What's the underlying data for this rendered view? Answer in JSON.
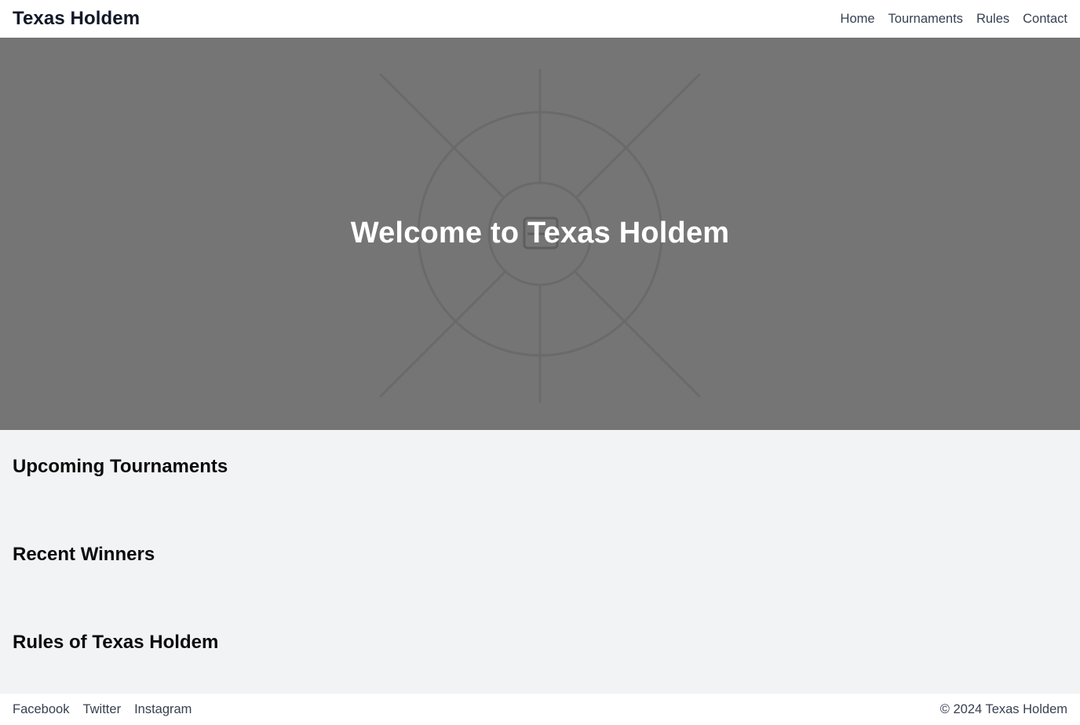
{
  "header": {
    "brand": "Texas Holdem",
    "nav": [
      {
        "label": "Home"
      },
      {
        "label": "Tournaments"
      },
      {
        "label": "Rules"
      },
      {
        "label": "Contact"
      }
    ]
  },
  "hero": {
    "title": "Welcome to Texas Holdem",
    "background_color": "#757575"
  },
  "sections": [
    {
      "title": "Upcoming Tournaments"
    },
    {
      "title": "Recent Winners"
    },
    {
      "title": "Rules of Texas Holdem"
    }
  ],
  "footer": {
    "links": [
      {
        "label": "Facebook"
      },
      {
        "label": "Twitter"
      },
      {
        "label": "Instagram"
      }
    ],
    "copyright": "© 2024 Texas Holdem"
  },
  "colors": {
    "page_bg": "#f2f3f5",
    "bar_bg": "#ffffff",
    "text": "#111827",
    "muted": "#374151"
  },
  "icons": [
    "broken-image-icon"
  ]
}
